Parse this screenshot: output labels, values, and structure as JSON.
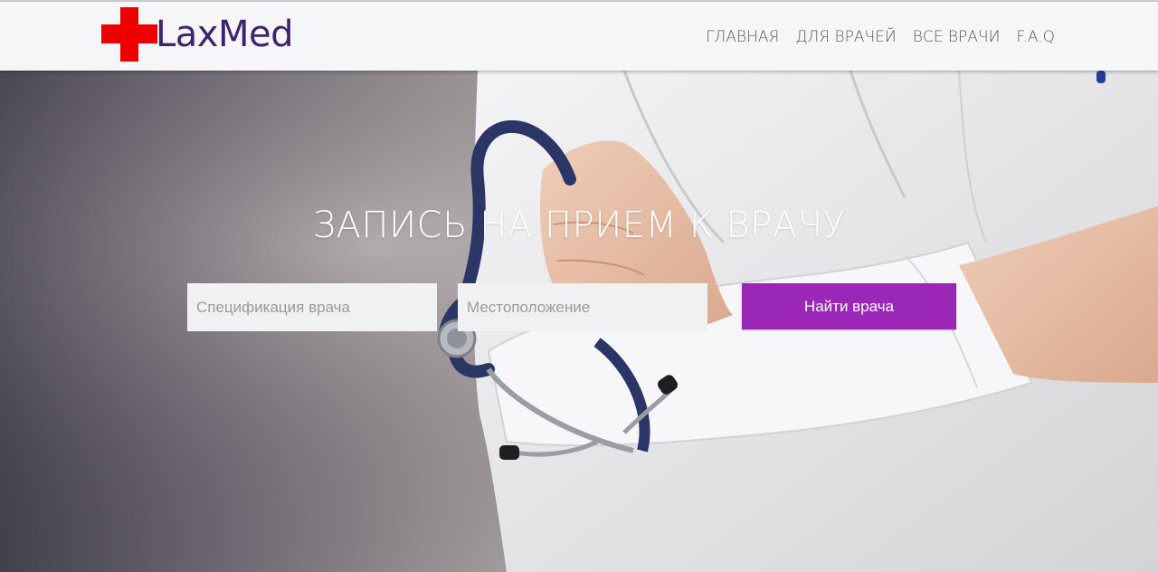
{
  "brand": {
    "name": "LaxMed",
    "cross_color": "#ee0000",
    "text_color": "#3c2470"
  },
  "nav": {
    "items": [
      {
        "label": "ГЛАВНАЯ"
      },
      {
        "label": "ДЛЯ ВРАЧЕЙ"
      },
      {
        "label": "ВСЕ ВРАЧИ"
      },
      {
        "label": "F.A.Q"
      }
    ]
  },
  "hero": {
    "title": "ЗАПИСЬ НА ПРИЕМ К ВРАЧУ",
    "specialty_placeholder": "Спецификация врача",
    "location_placeholder": "Местоположение",
    "search_button": "Найти врача",
    "accent": "#9a27b8"
  }
}
